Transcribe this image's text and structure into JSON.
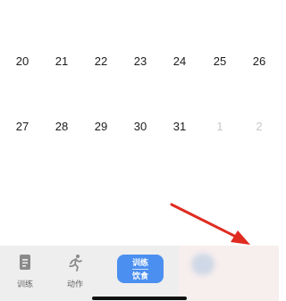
{
  "calendar": {
    "weeks": [
      [
        {
          "label": "20",
          "muted": false
        },
        {
          "label": "21",
          "muted": false
        },
        {
          "label": "22",
          "muted": false
        },
        {
          "label": "23",
          "muted": false
        },
        {
          "label": "24",
          "muted": false
        },
        {
          "label": "25",
          "muted": false
        },
        {
          "label": "26",
          "muted": false
        }
      ],
      [
        {
          "label": "27",
          "muted": false
        },
        {
          "label": "28",
          "muted": false
        },
        {
          "label": "29",
          "muted": false
        },
        {
          "label": "30",
          "muted": false
        },
        {
          "label": "31",
          "muted": false
        },
        {
          "label": "1",
          "muted": true
        },
        {
          "label": "2",
          "muted": true
        }
      ]
    ]
  },
  "tabbar": {
    "train": {
      "label": "训练",
      "icon": "document-icon"
    },
    "moves": {
      "label": "动作",
      "icon": "running-person-icon"
    },
    "toggle": {
      "line1": "训练",
      "line2": "饮食"
    }
  },
  "annotation": {
    "arrow_color": "#e02b20",
    "icon": "red-arrow"
  },
  "colors": {
    "accent": "#4b8ff0",
    "tabbar_bg": "#eeeeee",
    "muted_day": "#c9c9c9"
  }
}
